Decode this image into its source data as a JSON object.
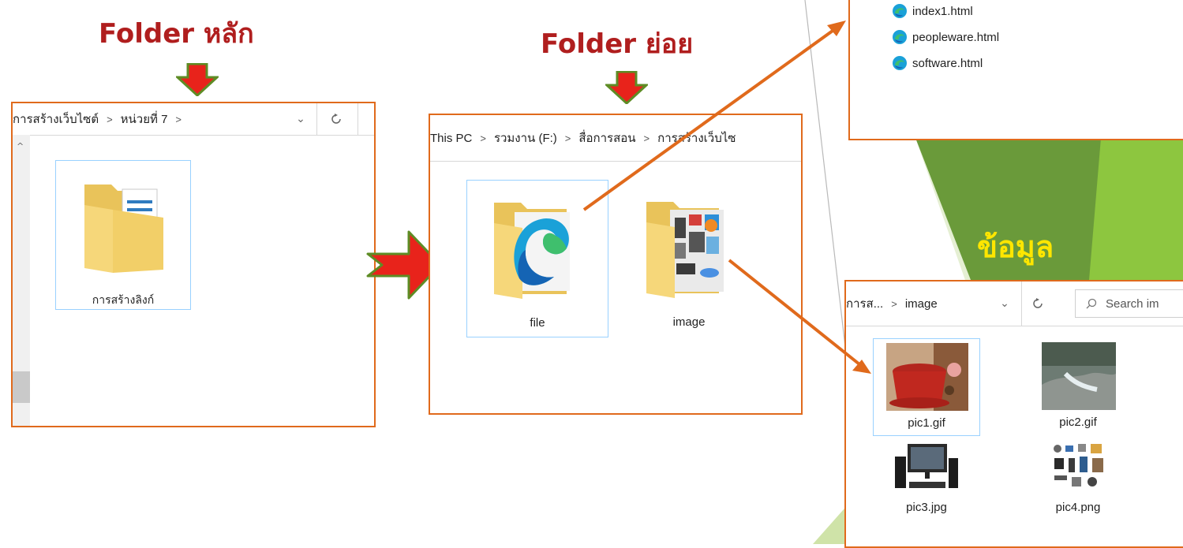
{
  "titles": {
    "main_folder": "Folder หลัก",
    "sub_folder": "Folder ย่อย",
    "data": "ข้อมูล"
  },
  "main_window": {
    "breadcrumb": [
      "การสร้างเว็บไซต์",
      "หน่วยที่ 7"
    ],
    "folder_label": "การสร้างลิงก์"
  },
  "sub_window": {
    "breadcrumb": [
      "This PC",
      "รวมงาน (F:)",
      "สื่อการสอน",
      "การสร้างเว็บไซ"
    ],
    "folders": [
      {
        "label": "file"
      },
      {
        "label": "image"
      }
    ]
  },
  "file_list": {
    "items": [
      "index1.html",
      "peopleware.html",
      "software.html"
    ]
  },
  "image_window": {
    "breadcrumb": [
      "การส...",
      "image"
    ],
    "search_placeholder": "Search im",
    "images": [
      {
        "label": "pic1.gif"
      },
      {
        "label": "pic2.gif"
      },
      {
        "label": "pic3.jpg"
      },
      {
        "label": "pic4.png"
      }
    ]
  },
  "colors": {
    "title_red": "#b01e1e",
    "panel_border": "#e06a1c",
    "arrow_orange": "#e06a1c",
    "green_dark": "#6a9a3a",
    "green_light": "#8dc63f",
    "data_text": "#ffe600"
  },
  "icons": [
    "down-arrow-icon",
    "right-arrow-icon",
    "folder-icon",
    "edge-icon",
    "refresh-icon",
    "chevron-down-icon",
    "search-icon",
    "scroll-up-icon"
  ]
}
